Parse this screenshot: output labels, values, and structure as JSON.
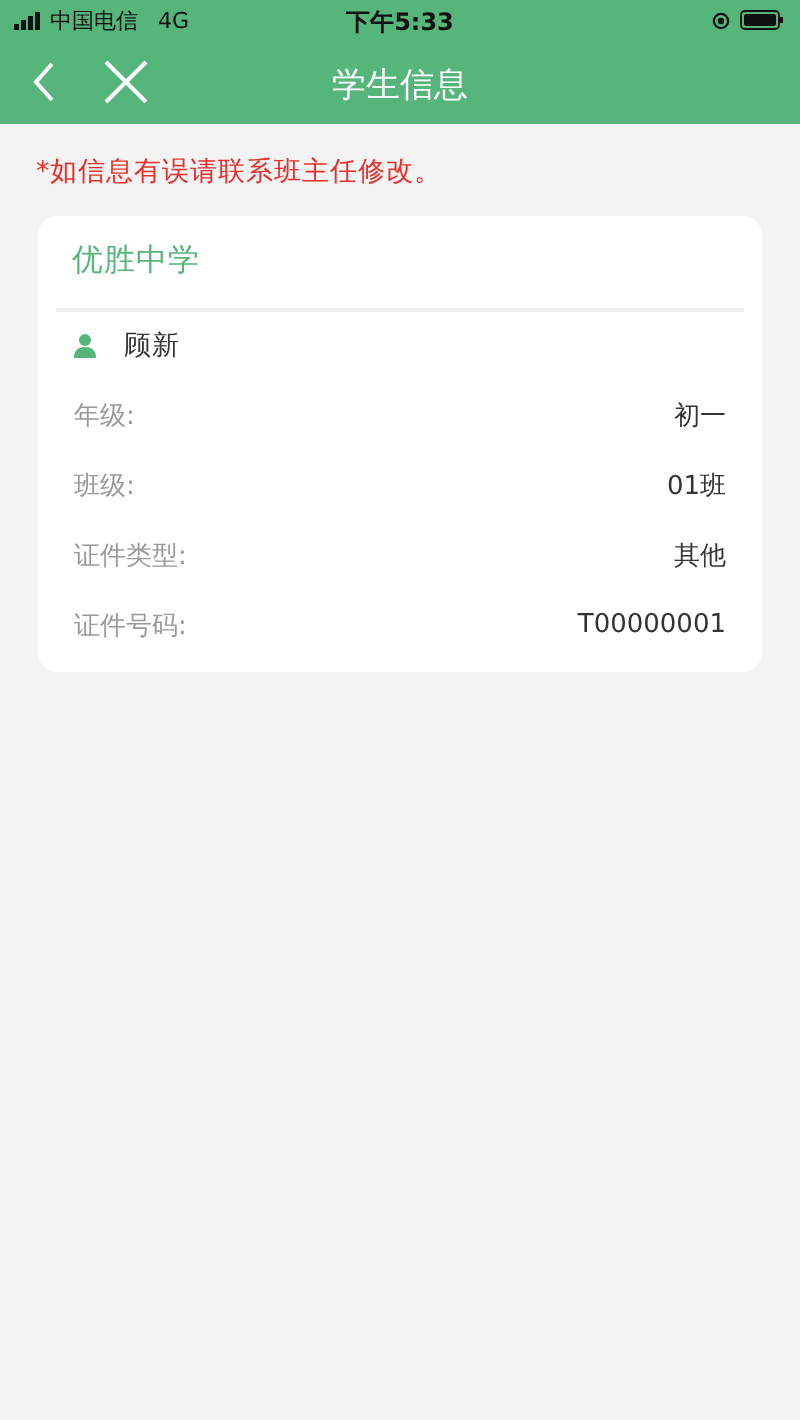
{
  "status_bar": {
    "carrier": "中国电信",
    "network": "4G",
    "time": "下午5:33"
  },
  "nav_bar": {
    "title": "学生信息"
  },
  "notice": "*如信息有误请联系班主任修改。",
  "card": {
    "school": "优胜中学",
    "student_name": "顾新",
    "fields": [
      {
        "label": "年级:",
        "value": "初一"
      },
      {
        "label": "班级:",
        "value": "01班"
      },
      {
        "label": "证件类型:",
        "value": "其他"
      },
      {
        "label": "证件号码:",
        "value": "T00000001"
      }
    ]
  }
}
